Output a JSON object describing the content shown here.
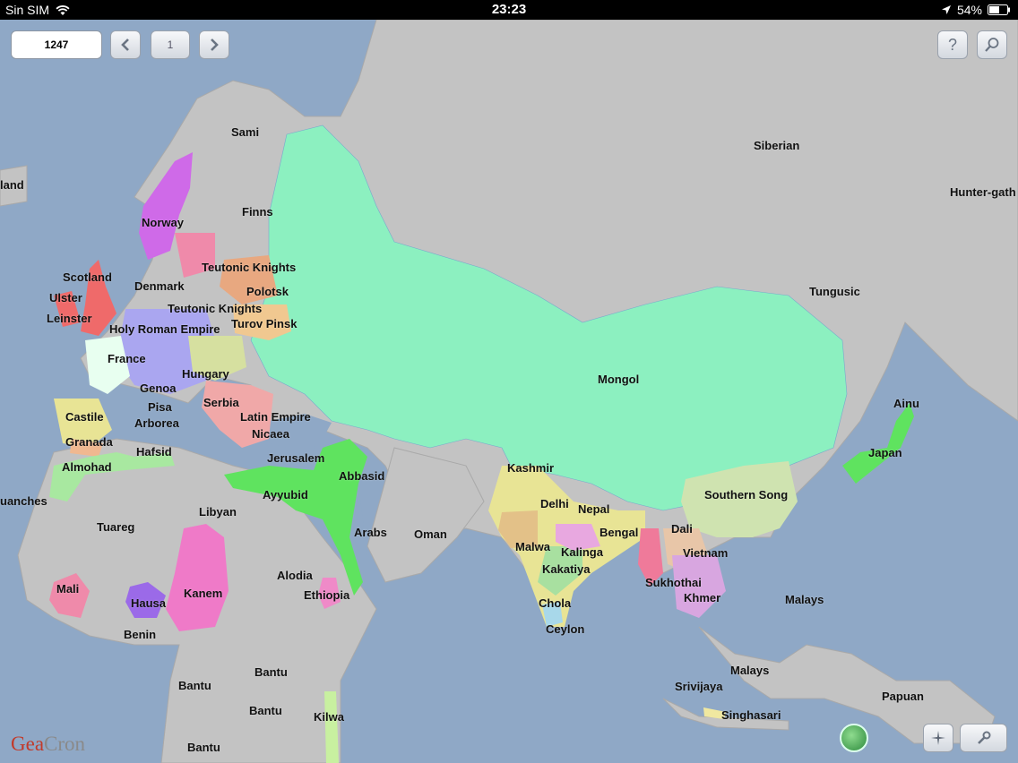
{
  "status_bar": {
    "carrier": "Sin SIM",
    "time": "23:23",
    "battery": "54%"
  },
  "toolbar": {
    "year": "1247",
    "page": "1"
  },
  "logo": {
    "part1": "Gea",
    "part2": "Cron"
  },
  "regions": [
    {
      "key": "sami",
      "label": "Sami"
    },
    {
      "key": "siberian",
      "label": "Siberian"
    },
    {
      "key": "hunter",
      "label": "Hunter-gath"
    },
    {
      "key": "iceland",
      "label": "land"
    },
    {
      "key": "norway",
      "label": "Norway"
    },
    {
      "key": "finns",
      "label": "Finns"
    },
    {
      "key": "teutonic1",
      "label": "Teutonic Knights"
    },
    {
      "key": "scotland",
      "label": "Scotland"
    },
    {
      "key": "denmark",
      "label": "Denmark"
    },
    {
      "key": "polotsk",
      "label": "Polotsk"
    },
    {
      "key": "tungusic",
      "label": "Tungusic"
    },
    {
      "key": "ulster",
      "label": "Ulster"
    },
    {
      "key": "teutonic2",
      "label": "Teutonic Knights"
    },
    {
      "key": "leinster",
      "label": "Leinster"
    },
    {
      "key": "turov",
      "label": "Turov Pinsk"
    },
    {
      "key": "hre",
      "label": "Holy Roman Empire"
    },
    {
      "key": "france",
      "label": "France"
    },
    {
      "key": "hungary",
      "label": "Hungary"
    },
    {
      "key": "mongol",
      "label": "Mongol"
    },
    {
      "key": "genoa",
      "label": "Genoa"
    },
    {
      "key": "serbia",
      "label": "Serbia"
    },
    {
      "key": "ainu",
      "label": "Ainu"
    },
    {
      "key": "pisa",
      "label": "Pisa"
    },
    {
      "key": "castile",
      "label": "Castile"
    },
    {
      "key": "latin",
      "label": "Latin Empire"
    },
    {
      "key": "arborea",
      "label": "Arborea"
    },
    {
      "key": "nicaea",
      "label": "Nicaea"
    },
    {
      "key": "granada",
      "label": "Granada"
    },
    {
      "key": "hafsid",
      "label": "Hafsid"
    },
    {
      "key": "jerusalem",
      "label": "Jerusalem"
    },
    {
      "key": "japan",
      "label": "Japan"
    },
    {
      "key": "almohad",
      "label": "Almohad"
    },
    {
      "key": "kashmir",
      "label": "Kashmir"
    },
    {
      "key": "abbasid",
      "label": "Abbasid"
    },
    {
      "key": "ayyubid",
      "label": "Ayyubid"
    },
    {
      "key": "southernsong",
      "label": "Southern Song"
    },
    {
      "key": "guanches",
      "label": "uanches"
    },
    {
      "key": "delhi",
      "label": "Delhi"
    },
    {
      "key": "libyan",
      "label": "Libyan"
    },
    {
      "key": "nepal",
      "label": "Nepal"
    },
    {
      "key": "tuareg",
      "label": "Tuareg"
    },
    {
      "key": "dali",
      "label": "Dali"
    },
    {
      "key": "arabs",
      "label": "Arabs"
    },
    {
      "key": "bengal",
      "label": "Bengal"
    },
    {
      "key": "oman",
      "label": "Oman"
    },
    {
      "key": "malwa",
      "label": "Malwa"
    },
    {
      "key": "kalinga",
      "label": "Kalinga"
    },
    {
      "key": "vietnam",
      "label": "Vietnam"
    },
    {
      "key": "kakatiya",
      "label": "Kakatiya"
    },
    {
      "key": "alodia",
      "label": "Alodia"
    },
    {
      "key": "sukhothai",
      "label": "Sukhothai"
    },
    {
      "key": "mali",
      "label": "Mali"
    },
    {
      "key": "kanem",
      "label": "Kanem"
    },
    {
      "key": "ethiopia",
      "label": "Ethiopia"
    },
    {
      "key": "khmer",
      "label": "Khmer"
    },
    {
      "key": "malays1",
      "label": "Malays"
    },
    {
      "key": "hausa",
      "label": "Hausa"
    },
    {
      "key": "chola",
      "label": "Chola"
    },
    {
      "key": "ceylon",
      "label": "Ceylon"
    },
    {
      "key": "benin",
      "label": "Benin"
    },
    {
      "key": "malays2",
      "label": "Malays"
    },
    {
      "key": "bantu1",
      "label": "Bantu"
    },
    {
      "key": "bantu2",
      "label": "Bantu"
    },
    {
      "key": "srivijaya",
      "label": "Srivijaya"
    },
    {
      "key": "papuan",
      "label": "Papuan"
    },
    {
      "key": "bantu3",
      "label": "Bantu"
    },
    {
      "key": "kilwa",
      "label": "Kilwa"
    },
    {
      "key": "singhasari",
      "label": "Singhasari"
    },
    {
      "key": "bantu4",
      "label": "Bantu"
    }
  ]
}
